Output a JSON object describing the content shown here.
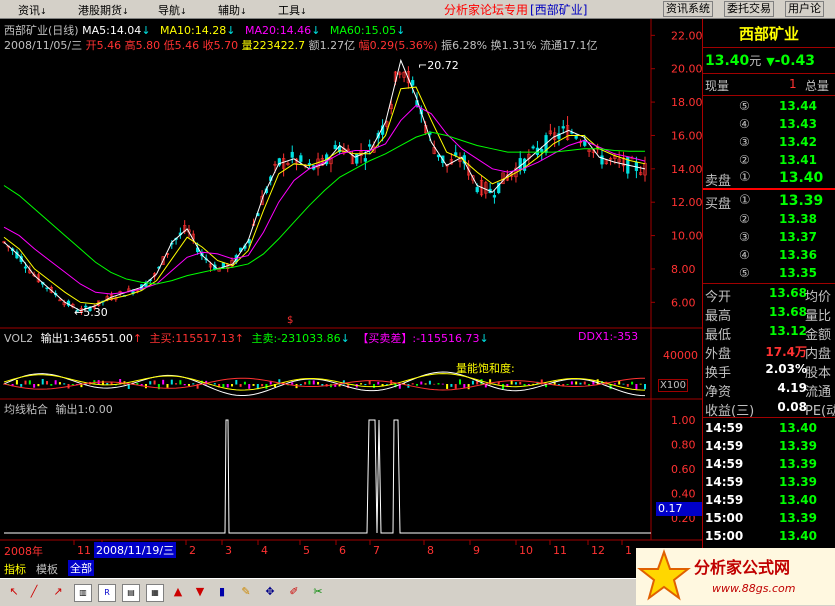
{
  "menubar": {
    "items": [
      {
        "label": "资讯",
        "arrow": "↓"
      },
      {
        "label": "港股期货",
        "arrow": "↓"
      },
      {
        "label": "导航",
        "arrow": "↓"
      },
      {
        "label": "辅助",
        "arrow": "↓"
      },
      {
        "label": "工具",
        "arrow": "↓"
      }
    ],
    "forum_title": "分析家论坛专用",
    "stock_tag": "[西部矿业]",
    "buttons": [
      "资讯系统",
      "委托交易",
      "用户论"
    ]
  },
  "price_chart": {
    "title": "西部矿业(日线)",
    "ma5": "MA5:14.04",
    "ma10": "MA10:14.28",
    "ma20": "MA20:14.46",
    "ma60": "MA60:15.05",
    "date_line_prefix": "2008/11/05/三",
    "open": "开5.46",
    "high": "高5.80",
    "low": "低5.46",
    "close": "收5.70",
    "volume": "量223422.7",
    "amount": "额1.27亿",
    "change": "幅0.29(5.36%)",
    "amplitude": "振6.28%",
    "turnover": "换1.31%",
    "float": "流通17.1亿",
    "y_ticks": [
      "22.00",
      "20.00",
      "18.00",
      "16.00",
      "14.00",
      "12.00",
      "10.00",
      "8.00",
      "6.00"
    ],
    "high_label": "20.72",
    "low_label": "5.30",
    "marker": "$"
  },
  "volume_chart": {
    "title": "VOL2",
    "output1": "输出1:346551.00",
    "buy": "主买:115517.13",
    "sell": "主卖:-231033.86",
    "diff": "【买卖差】:-115516.73",
    "ddx": "DDX1:-353",
    "y_tick": "40000",
    "annotation": "量能饱和度:",
    "x100": "X100"
  },
  "ma_chart": {
    "title": "均线粘合",
    "output": "输出1:0.00",
    "y_ticks": [
      "1.00",
      "0.80",
      "0.60",
      "0.40",
      "0.20"
    ],
    "value_box": "0.17"
  },
  "x_axis": {
    "year": "2008年",
    "ticks": [
      "11",
      "12",
      "2",
      "3",
      "4",
      "5",
      "6",
      "7",
      "8",
      "9",
      "10",
      "11",
      "12",
      "1"
    ],
    "cursor_date": "2008/11/19/三"
  },
  "tabs": [
    "指标",
    "模板",
    "全部"
  ],
  "right_panel": {
    "stock_name": "西部矿业",
    "price": "13.40",
    "price_unit": "元",
    "change_arrow": "▼",
    "change": "-0.43",
    "current_vol_label": "现量",
    "current_vol": "1",
    "total_vol_label": "总量",
    "sell_orders": [
      {
        "level": "⑤",
        "price": "13.44"
      },
      {
        "level": "④",
        "price": "13.43"
      },
      {
        "level": "③",
        "price": "13.42"
      },
      {
        "level": "②",
        "price": "13.41"
      }
    ],
    "sell1_label": "卖盘",
    "sell1_level": "①",
    "sell1_price": "13.40",
    "buy1_label": "买盘",
    "buy1_level": "①",
    "buy1_price": "13.39",
    "buy_orders": [
      {
        "level": "②",
        "price": "13.38"
      },
      {
        "level": "③",
        "price": "13.37"
      },
      {
        "level": "④",
        "price": "13.36"
      },
      {
        "level": "⑤",
        "price": "13.35"
      }
    ],
    "stats": [
      {
        "label": "今开",
        "value": "13.68",
        "right": "均价"
      },
      {
        "label": "最高",
        "value": "13.68",
        "right": "量比"
      },
      {
        "label": "最低",
        "value": "13.12",
        "right": "金额"
      },
      {
        "label": "外盘",
        "value": "17.4万",
        "right": "内盘"
      },
      {
        "label": "换手",
        "value": "2.03%",
        "right": "股本"
      },
      {
        "label": "净资",
        "value": "4.19",
        "right": "流通"
      },
      {
        "label": "收益(三)",
        "value": "0.08",
        "right": "PE(动"
      }
    ],
    "ticks": [
      {
        "time": "14:59",
        "price": "13.40"
      },
      {
        "time": "14:59",
        "price": "13.39"
      },
      {
        "time": "14:59",
        "price": "13.39"
      },
      {
        "time": "14:59",
        "price": "13.39"
      },
      {
        "time": "14:59",
        "price": "13.40"
      },
      {
        "time": "15:00",
        "price": "13.39"
      },
      {
        "time": "15:00",
        "price": "13.40"
      }
    ]
  },
  "watermark": {
    "text": "分析家公式网",
    "url": "www.88gs.com"
  },
  "colors": {
    "up": "#ff3232",
    "down": "#00e0e0",
    "ma5": "#ffffff",
    "ma10": "#ffff00",
    "ma20": "#ff00ff",
    "ma60": "#00ff00",
    "grid": "#a00000",
    "price_green": "#00ff00",
    "label_red": "#ff3232"
  },
  "chart_data": {
    "type": "line",
    "series": [
      {
        "name": "MA5",
        "values": [
          9.6,
          8.8,
          7.6,
          6.8,
          6.0,
          5.5,
          5.8,
          6.3,
          6.6,
          6.9,
          7.7,
          9.6,
          10.4,
          8.8,
          8.0,
          8.3,
          9.7,
          12.4,
          14.3,
          14.6,
          14.0,
          14.3,
          15.4,
          14.7,
          15.1,
          16.8,
          20.5,
          18.3,
          15.6,
          14.2,
          14.7,
          13.0,
          12.6,
          13.6,
          14.3,
          15.1,
          15.9,
          16.3,
          15.9,
          14.7,
          14.4,
          14.2,
          14.0
        ]
      },
      {
        "name": "MA10",
        "values": [
          9.9,
          9.2,
          8.0,
          7.3,
          6.6,
          6.0,
          5.9,
          6.2,
          6.4,
          6.7,
          7.3,
          8.6,
          9.9,
          9.3,
          8.5,
          8.2,
          9.1,
          11.5,
          13.7,
          14.3,
          14.2,
          14.5,
          15.1,
          14.9,
          14.9,
          16.0,
          18.8,
          18.9,
          16.9,
          15.0,
          14.6,
          13.8,
          13.1,
          13.5,
          14.0,
          14.7,
          15.5,
          16.0,
          16.0,
          15.2,
          14.8,
          14.5,
          14.3
        ]
      },
      {
        "name": "MA20",
        "values": [
          10.5,
          10.0,
          9.2,
          8.5,
          7.8,
          7.1,
          6.6,
          6.5,
          6.6,
          6.8,
          7.1,
          7.9,
          8.7,
          9.0,
          8.9,
          8.6,
          8.8,
          10.2,
          12.0,
          13.3,
          14.0,
          14.4,
          14.9,
          15.1,
          15.1,
          15.5,
          16.9,
          17.8,
          17.3,
          16.1,
          15.2,
          14.6,
          14.0,
          13.8,
          14.0,
          14.4,
          14.9,
          15.4,
          15.7,
          15.3,
          14.9,
          14.7,
          14.46
        ]
      },
      {
        "name": "MA60",
        "values": [
          13.0,
          12.4,
          11.6,
          10.8,
          10.0,
          9.2,
          8.4,
          7.8,
          7.4,
          7.2,
          7.1,
          7.3,
          7.6,
          7.8,
          8.0,
          8.1,
          8.3,
          8.9,
          9.8,
          10.8,
          11.8,
          12.7,
          13.5,
          14.0,
          14.5,
          14.9,
          15.4,
          15.9,
          16.2,
          16.0,
          15.7,
          15.4,
          15.2,
          15.0,
          15.0,
          15.0,
          15.0,
          15.1,
          15.2,
          15.2,
          15.1,
          15.05,
          15.05
        ]
      }
    ],
    "ylim": [
      5,
      22.5
    ],
    "ylabel": "",
    "xlabel": "",
    "title": "西部矿业(日线)",
    "annotations": [
      {
        "label": "20.72"
      },
      {
        "label": "5.30"
      }
    ]
  }
}
